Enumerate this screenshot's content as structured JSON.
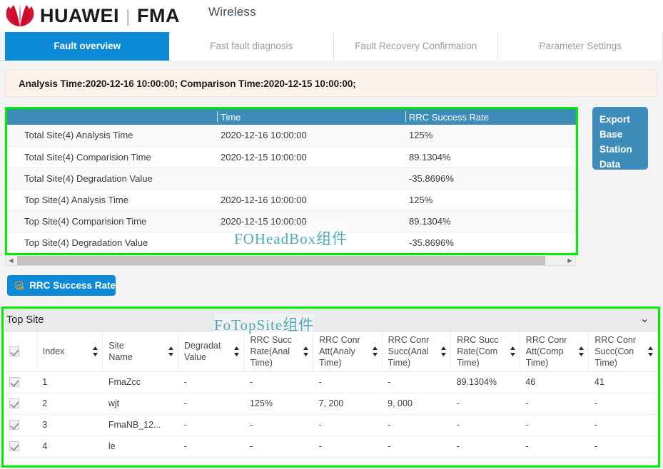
{
  "brand": {
    "name": "HUAWEI",
    "separator": "|",
    "product": "FMA",
    "logo_icon": "huawei-flower-logo"
  },
  "header": {
    "module_title": "Wireless"
  },
  "tabs": [
    {
      "label": "Fault overview",
      "active": true
    },
    {
      "label": "Fast fault diagnosis",
      "active": false
    },
    {
      "label": "Fault Recovery Confirmation",
      "active": false
    },
    {
      "label": "Parameter Settings",
      "active": false
    }
  ],
  "banner": {
    "text": "Analysis Time:2020-12-16 10:00:00; Comparison Time:2020-12-15 10:00:00;"
  },
  "head_table": {
    "columns": [
      "",
      "Time",
      "RRC Success Rate"
    ],
    "rows": [
      {
        "label": "Total Site(4) Analysis Time",
        "time": "2020-12-16 10:00:00",
        "rate": "125%"
      },
      {
        "label": "Total Site(4) Comparision Time",
        "time": "2020-12-15 10:00:00",
        "rate": "89.1304%"
      },
      {
        "label": "Total Site(4) Degradation Value",
        "time": "",
        "rate": "-35.8696%"
      },
      {
        "label": "Top Site(4) Analysis Time",
        "time": "2020-12-16 10:00:00",
        "rate": "125%"
      },
      {
        "label": "Top Site(4) Comparision Time",
        "time": "2020-12-15 10:00:00",
        "rate": "89.1304%"
      },
      {
        "label": "Top Site(4) Degradation Value",
        "time": "",
        "rate": "-35.8696%"
      }
    ]
  },
  "export_button": {
    "label": "Export Base Station Data"
  },
  "rrc_button": {
    "label": "RRC Success Rate",
    "icon": "chart-analysis-icon"
  },
  "scrollbar": {
    "left_arrow": "◀",
    "right_arrow": "▶"
  },
  "top_site": {
    "title": "Top Site",
    "collapse_icon": "chevron-down-icon",
    "columns": [
      "Index",
      "Site\nName",
      "Degradat\nValue",
      "RRC Succ\nRate(Anal\nTime)",
      "RRC Conr\nAtt(Analy\nTime)",
      "RRC Conr\nSucc(Anal\nTime)",
      "RRC Succ\nRate(Com\nTime)",
      "RRC Conr\nAtt(Comp\nTime)",
      "RRC Conr\nSucc(Con\nTime)"
    ],
    "rows": [
      {
        "index": "1",
        "site_name": "FmaZcc",
        "degradation": "-",
        "rate_analysis": "-",
        "att_analysis": "-",
        "succ_analysis": "-",
        "rate_compare": "89.1304%",
        "att_compare": "46",
        "succ_compare": "41"
      },
      {
        "index": "2",
        "site_name": "wjt",
        "degradation": "-",
        "rate_analysis": "125%",
        "att_analysis": "7, 200",
        "succ_analysis": "9, 000",
        "rate_compare": "-",
        "att_compare": "-",
        "succ_compare": "-"
      },
      {
        "index": "3",
        "site_name": "FmaNB_12...",
        "degradation": "-",
        "rate_analysis": "-",
        "att_analysis": "-",
        "succ_analysis": "-",
        "rate_compare": "-",
        "att_compare": "-",
        "succ_compare": "-"
      },
      {
        "index": "4",
        "site_name": "le",
        "degradation": "-",
        "rate_analysis": "-",
        "att_analysis": "-",
        "succ_analysis": "-",
        "rate_compare": "-",
        "att_compare": "-",
        "succ_compare": "-"
      }
    ]
  },
  "annotations": {
    "head_watermark": "FOHeadBox组件",
    "top_watermark": "FoTopSite组件"
  },
  "colors": {
    "tab_active": "#0d8ad6",
    "table_header": "#3e8cba",
    "banner_bg": "#fdf3ea",
    "annotation_green": "#00ee00",
    "watermark": "#4fa8b8",
    "logo_red": "#cf0a2c"
  }
}
